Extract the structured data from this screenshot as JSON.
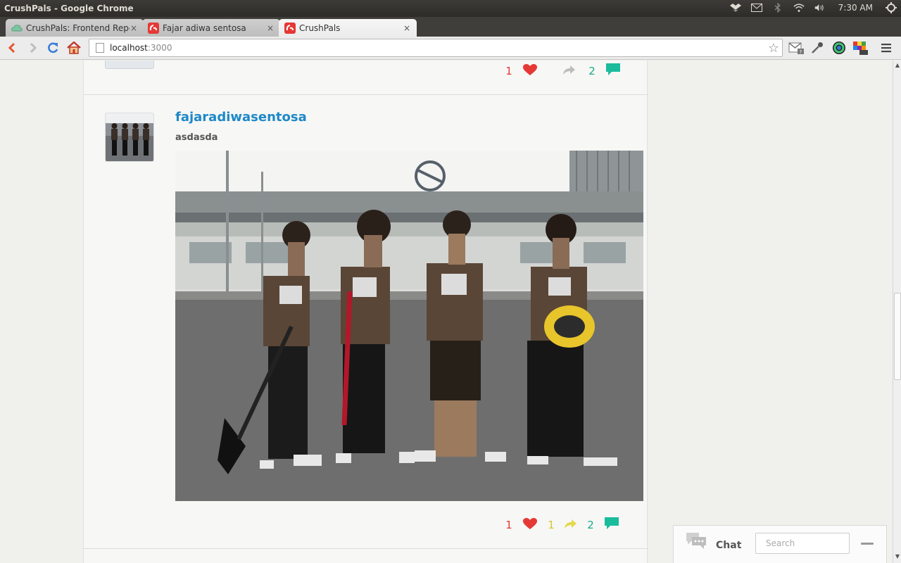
{
  "window": {
    "title": "CrushPals - Google Chrome"
  },
  "system_tray": {
    "icons": [
      "dropbox-icon",
      "mail-icon",
      "bluetooth-icon",
      "wifi-icon",
      "volume-icon",
      "power-icon"
    ],
    "clock": "7:30 AM"
  },
  "tabs": [
    {
      "label": "CrushPals: Frontend Repo",
      "close": "×",
      "active": false
    },
    {
      "label": "Fajar adiwa sentosa",
      "close": "×",
      "active": false
    },
    {
      "label": "CrushPals",
      "close": "×",
      "active": true
    }
  ],
  "toolbar": {
    "url_host": "localhost",
    "url_port": ":3000"
  },
  "feed": {
    "previous_post": {
      "likes": "1",
      "comments": "2"
    },
    "post": {
      "username": "fajaradiwasentosa",
      "text": "asdasda",
      "likes": "1",
      "shares": "1",
      "comments": "2"
    }
  },
  "chat": {
    "title": "Chat",
    "search_placeholder": "Search"
  },
  "colors": {
    "like": "#e53935",
    "share": "#d6c62a",
    "comment": "#1aa989",
    "link": "#1e88c8"
  }
}
